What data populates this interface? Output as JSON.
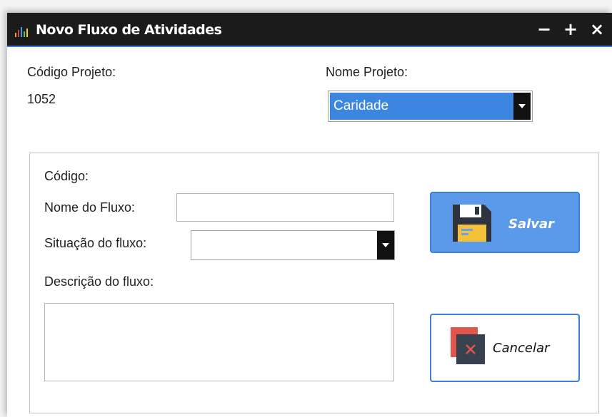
{
  "window": {
    "title": "Novo Fluxo de Atividades",
    "controls": {
      "minimize": "−",
      "maximize": "+",
      "close": "×"
    }
  },
  "project": {
    "code_label": "Código Projeto:",
    "code_value": "1052",
    "name_label": "Nome Projeto:",
    "name_selected": "Caridade"
  },
  "form": {
    "code_label": "Código:",
    "flow_name_label": "Nome do Fluxo:",
    "flow_name_value": "",
    "status_label": "Situação do fluxo:",
    "status_selected": "",
    "description_label": "Descrição do fluxo:",
    "description_value": ""
  },
  "buttons": {
    "save_label": "Salvar",
    "cancel_label": "Cancelar"
  },
  "icons": {
    "app": "bar-chart-icon",
    "save": "floppy-disk-icon",
    "cancel": "cancel-x-icon"
  },
  "colors": {
    "titlebar": "#1b1b1b",
    "accent": "#3d86e0",
    "save_button": "#5b9ae8",
    "button_border": "#3b7fd8",
    "cancel_icon_red": "#e0564a",
    "cancel_icon_dark": "#374150"
  }
}
